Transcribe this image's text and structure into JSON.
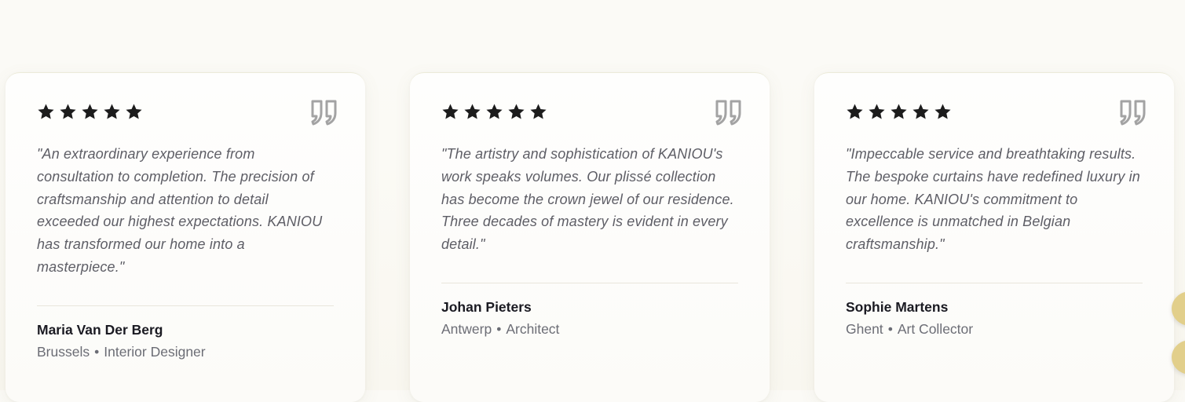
{
  "testimonials": [
    {
      "rating": 5,
      "quote": "\"An extraordinary experience from consultation to completion. The precision of craftsmanship and attention to detail exceeded our highest expectations. KANIOU has transformed our home into a masterpiece.\"",
      "name": "Maria Van Der Berg",
      "city": "Brussels",
      "role": "Interior Designer"
    },
    {
      "rating": 5,
      "quote": "\"The artistry and sophistication of KANIOU's work speaks volumes. Our plissé collection has become the crown jewel of our residence. Three decades of mastery is evident in every detail.\"",
      "name": "Johan Pieters",
      "city": "Antwerp",
      "role": "Architect"
    },
    {
      "rating": 5,
      "quote": "\"Impeccable service and breathtaking results. The bespoke curtains have redefined luxury in our home. KANIOU's commitment to excellence is unmatched in Belgian craftsmanship.\"",
      "name": "Sophie Martens",
      "city": "Ghent",
      "role": "Art Collector"
    }
  ],
  "separator": "•",
  "icons": {
    "star": "star-icon",
    "quote": "quote-icon"
  },
  "colors": {
    "star": "#1c1c1c",
    "quote_icon": "#a3a3a3",
    "accent": "#e2cf8b"
  }
}
